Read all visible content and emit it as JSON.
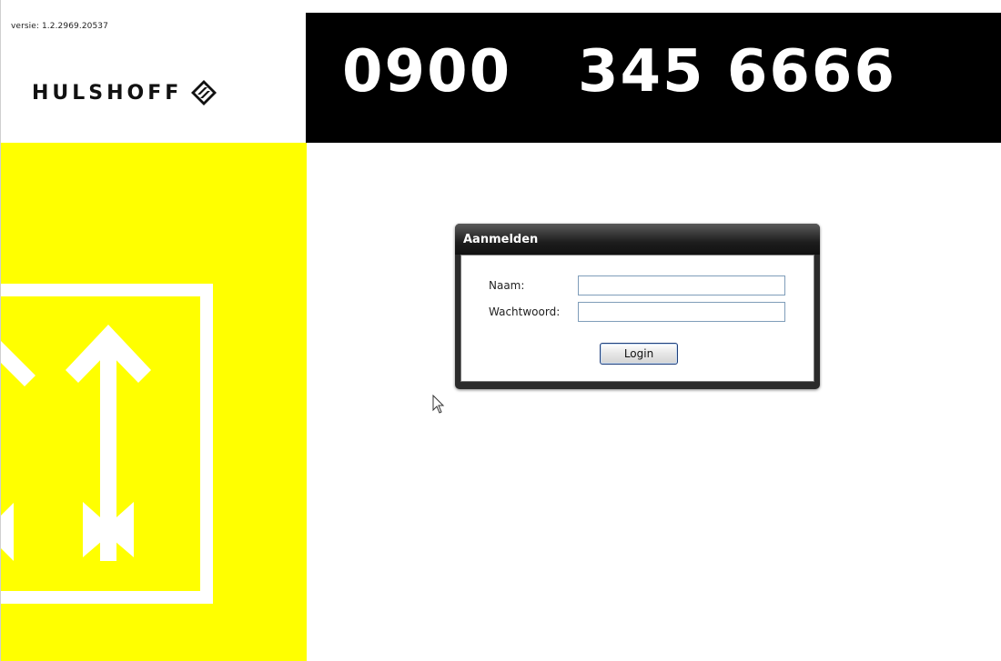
{
  "app": {
    "version_text": "versie: 1.2.2969.20537",
    "brand_name": "HULSHOFF",
    "brand_logo_icon": "hulshoff-diamond-logo-icon",
    "phone_number": "0900   345 6666"
  },
  "login": {
    "title": "Aanmelden",
    "name_label": "Naam:",
    "name_value": "",
    "password_label": "Wachtwoord:",
    "password_value": "",
    "button_label": "Login"
  },
  "colors": {
    "yellow": "#ffff00",
    "black": "#000000",
    "dialog_frame": "#2b2b2b"
  },
  "icons": {
    "cursor": "mouse-pointer-icon",
    "decor": "arrow-decoration-icon"
  }
}
